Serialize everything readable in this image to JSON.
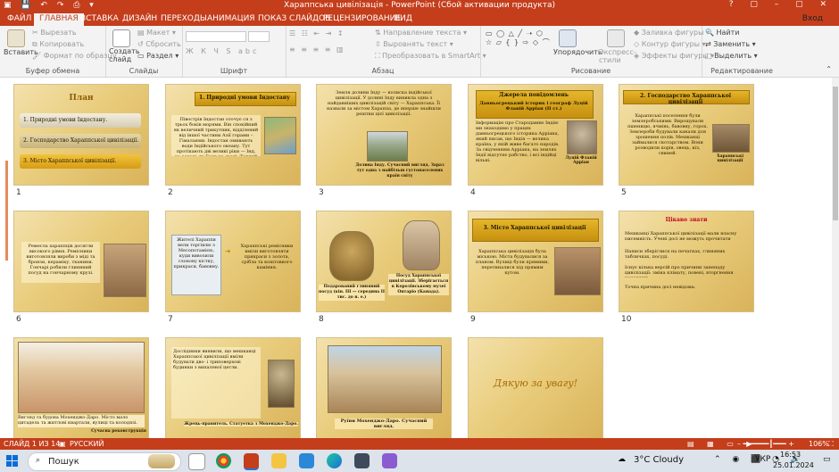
{
  "app": {
    "title": "Хараппська цивілізація - PowerPoint (Сбой активации продукта)",
    "login_label": "Вход",
    "window_controls": "? ▢ – ▢ ✕"
  },
  "tabs": [
    {
      "label": "ФАЙЛ"
    },
    {
      "label": "ГЛАВНАЯ"
    },
    {
      "label": "ВСТАВКА"
    },
    {
      "label": "ДИЗАЙН"
    },
    {
      "label": "ПЕРЕХОДЫ"
    },
    {
      "label": "АНИМАЦИЯ"
    },
    {
      "label": "ПОКАЗ СЛАЙДОВ"
    },
    {
      "label": "РЕЦЕНЗИРОВАНИЕ"
    },
    {
      "label": "ВИД"
    }
  ],
  "ribbon": {
    "clipboard": {
      "paste": "Вставить",
      "cut": "Вырезать",
      "copy": "Копировать",
      "format_painter": "Формат по образцу",
      "group": "Буфер обмена"
    },
    "slides": {
      "new_slide": "Создать слайд",
      "layout": "Макет",
      "reset": "Сбросить",
      "section": "Раздел",
      "group": "Слайды"
    },
    "font": {
      "group": "Шрифт"
    },
    "paragraph": {
      "text_direction": "Направление текста",
      "align_text": "Выровнять текст",
      "smartart": "Преобразовать в SmartArt",
      "group": "Абзац"
    },
    "drawing": {
      "arrange": "Упорядочить",
      "quick_styles": "Экспресс-стили",
      "shape_fill": "Заливка фигуры",
      "shape_outline": "Контур фигуры",
      "shape_effects": "Эффекты фигуры",
      "group": "Рисование"
    },
    "editing": {
      "find": "Найти",
      "replace": "Заменить",
      "select": "Выделить",
      "group": "Редактирование"
    }
  },
  "slides": [
    {
      "num": "1",
      "title": "План",
      "items": [
        "1. Природні умови Індостану.",
        "2. Господарство Хараппської цивілізації.",
        "3. Місто Хараппської цивілізації."
      ]
    },
    {
      "num": "2",
      "title": "1. Природні умови Індостану",
      "text": "Півострів Індостан оточує ся з трьох боків морями. Він спокійний як величний трикутник, відділений від іншої частини Азії горами – Гімалаями. Індостан омивають води Індійського океану. Тут протікають дві великі ріки — Інд, на заході, та Ганг на сході. Теплий клімат, родючі ґрунти сприяли розвитку землеробства."
    },
    {
      "num": "3",
      "text": "Земля долини Інду — колиска індійської цивілізації. У долині Інду виникла одна з найдавніших цивілізацій світу — Хараппська. Її назвали за містом Хараппа, де вперше знайшли рештки цієї цивілізації.",
      "caption": "Долина Інду. Сучасний вигляд. Зараз тут одна з найбільш густонаселених країн світу"
    },
    {
      "num": "4",
      "title": "Джерела повідомлень",
      "subtitle": "Давньогрецький історик і географ Луцій Флавій Арріан (II ст.)",
      "text": "Інформацію про Стародавню Індію ми знаходимо у працях давньогрецького історика Арріана, який писав, що Індія — велика країна, у якій живе багато народів. За свідченням Арріана, на землях Індії відсутнє рабство, і всі індійці вільні.",
      "caption": "Луцій Флавій Арріан"
    },
    {
      "num": "5",
      "title": "2. Господарство Хараппської цивілізації",
      "text": "Хараппські поселення були землеробськими. Вирощували пшеницю, ячмінь, бавовну, горох. Землероби будували канали для зрошення полів. Мешканці займалися скотарством. Вони розводили корів, овець, кіз, свиней.",
      "caption": "Хараппські цивілізації"
    },
    {
      "num": "6",
      "text": "Ремесла хараппців досягли високого рівня. Ремісники виготовляли вироби з міді та бронзи, кераміку, тканини. Гончарі робили глиняний посуд на гончарному крузі."
    },
    {
      "num": "7",
      "left": "Жителі Хараппи вели торгівлю з Месопотамією, куди вивозили слонову кістку, прикраси, бавовну.",
      "right": "Хараппські ремісники вміли виготовляти прикраси з золота, срібла та коштовного каміння."
    },
    {
      "num": "8",
      "caption_left": "Подарований глиняний посуд (кін. III — середина II тис. до н. е.)",
      "caption_right": "Посуд Хараппської цивілізації. Зберігається в Королівському музеї Онтаріо (Канада)."
    },
    {
      "num": "9",
      "title": "3. Місто Хараппської цивілізації",
      "text": "Хараппська цивілізація була міською. Міста будувалися за планом. Вулиці були прямими, перетиналися під прямим кутом."
    },
    {
      "num": "10",
      "title": "Цікаво знати",
      "p1": "Мешканці Хараппської цивілізації мали власну писемність. Учені досі не можуть прочитати написи.",
      "p2": "Написи зберіглися на печатках, глиняних табличках, посуді.",
      "p3": "Існує кілька версій про причини занепаду цивілізації: зміна клімату, повені, вторгнення кочовиків.",
      "p4": "Точна причина досі невідома."
    },
    {
      "num": "11",
      "caption": "Вигляд та будова Мохенджо-Даро. Місто мало цитадель та житлові квартали, вулиці та колодязі.",
      "note": "Сучасна реконструкція"
    },
    {
      "num": "12",
      "text": "Дослідники виявили, що мешканці Хараппської цивілізації вміли будувати дво- і триповерхові будинки з випаленої цегли.",
      "caption": "Жрець-правитель. Статуетка з Мохенджо-Даро."
    },
    {
      "num": "13",
      "caption": "Руїни Мохенджо-Даро. Сучасний вигляд."
    },
    {
      "num": "14",
      "title": "Дякую за увагу!"
    }
  ],
  "status": {
    "slide": "СЛАЙД 1 ИЗ 14",
    "language": "РУССКИЙ",
    "zoom": "106%"
  },
  "taskbar": {
    "search_placeholder": "Пошук",
    "weather": "3°C Cloudy",
    "lang": "УКР",
    "time": "16:53",
    "date": "25.01.2024"
  },
  "colors": {
    "accent": "#c43e1c",
    "slide_gold": "#e5b62a"
  }
}
